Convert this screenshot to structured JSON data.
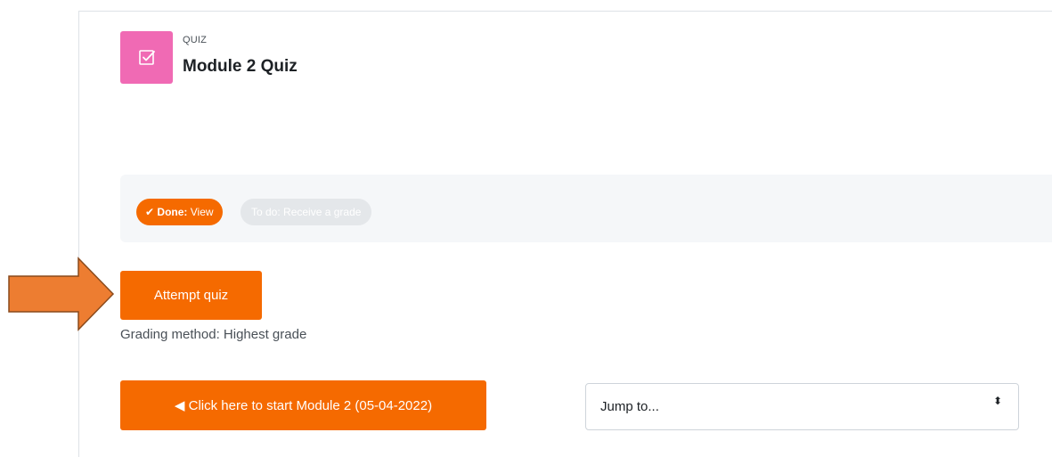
{
  "activity": {
    "type_label": "QUIZ",
    "title": "Module 2 Quiz",
    "icon": "quiz-checkbox-icon",
    "icon_color": "#f06ab4"
  },
  "completion": {
    "done_prefix": "Done:",
    "done_value": "View",
    "todo_text": "To do: Receive a grade",
    "done_color": "#f56a00",
    "todo_color": "#e4e7ea"
  },
  "actions": {
    "attempt_label": "Attempt quiz",
    "grading_method": "Grading method: Highest grade"
  },
  "navigation": {
    "prev_label": "◀ Click here to start Module 2 (05-04-2022)",
    "jump_placeholder": "Jump to...",
    "jump_caret": "⬍"
  },
  "annotation": {
    "arrow_color": "#ed7d31",
    "arrow_icon": "right-arrow-icon"
  },
  "colors": {
    "accent": "#f56a00"
  }
}
